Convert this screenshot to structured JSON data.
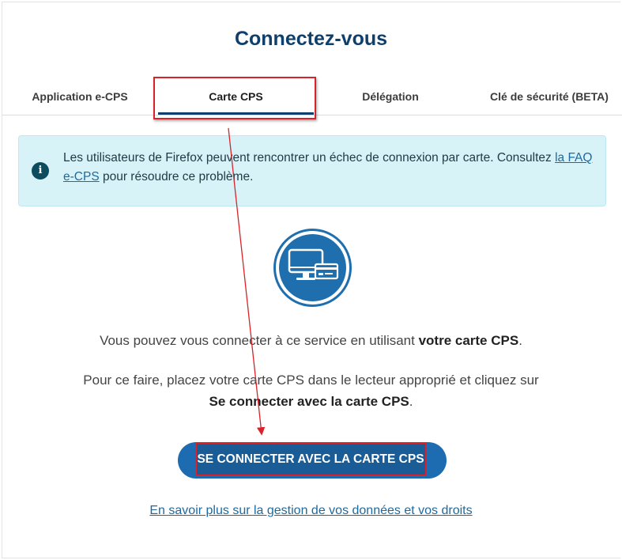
{
  "page": {
    "title": "Connectez-vous"
  },
  "tabs": [
    {
      "label": "Application e-CPS",
      "active": false
    },
    {
      "label": "Carte CPS",
      "active": true
    },
    {
      "label": "Délégation",
      "active": false
    },
    {
      "label": "Clé de sécurité (BETA)",
      "active": false
    }
  ],
  "alert": {
    "icon": "info-icon",
    "text_before": "Les utilisateurs de Firefox peuvent rencontrer un échec de connexion par carte. Consultez ",
    "link_text": "la FAQ e-CPS",
    "text_after": " pour résoudre ce problème."
  },
  "illustration": {
    "icon": "computer-card-icon"
  },
  "info": {
    "line1_before": "Vous pouvez vous connecter à ce service en utilisant ",
    "line1_bold": "votre carte CPS",
    "line1_after": ".",
    "line2_before": "Pour ce faire, placez votre carte CPS dans le lecteur approprié et cliquez sur",
    "line2_bold": "Se connecter avec la carte CPS",
    "line2_after": "."
  },
  "cta": {
    "label": "SE CONNECTER AVEC LA CARTE CPS"
  },
  "footer": {
    "link_text": "En savoir plus sur la gestion de vos données et vos droits"
  },
  "colors": {
    "brand": "#0f3f6b",
    "button": "#1d6bb1",
    "highlight": "#d8232a",
    "alert_bg": "#d8f3f8"
  }
}
